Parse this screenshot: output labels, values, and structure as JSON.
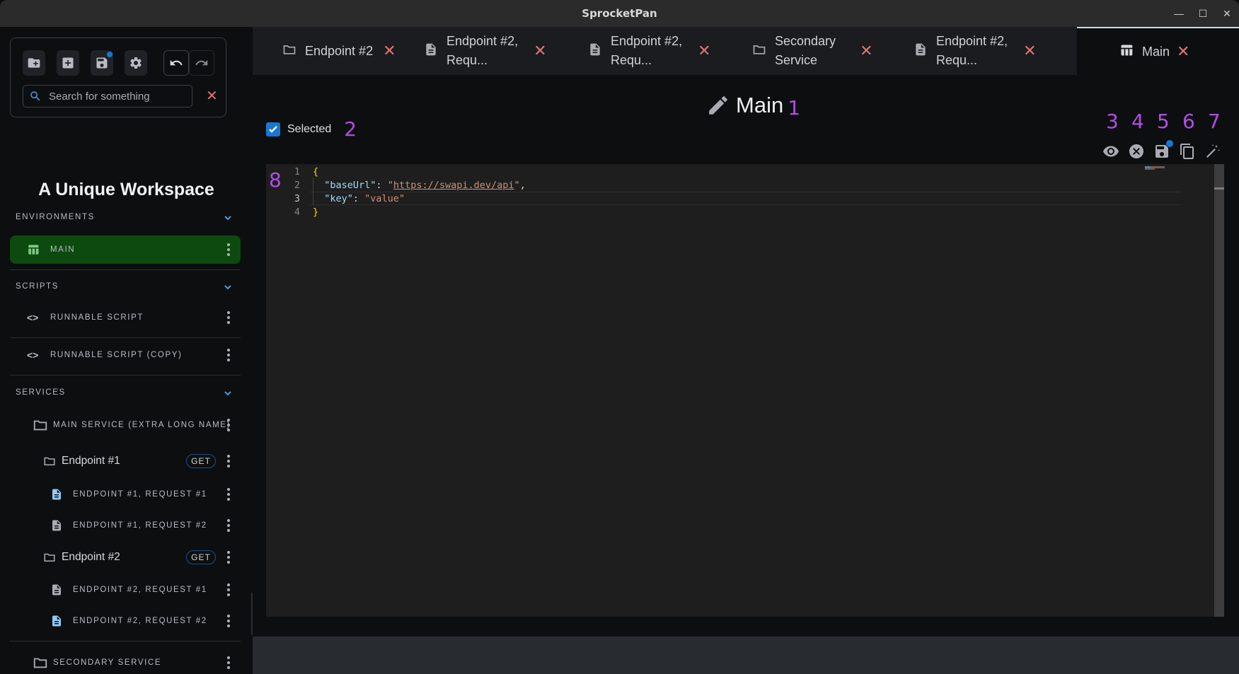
{
  "window": {
    "title": "SprocketPan",
    "controls": [
      "minimize",
      "maximize",
      "close"
    ]
  },
  "sidebar": {
    "toolbar": {
      "buttons": [
        {
          "name": "new-folder",
          "icon": "create-new-folder-icon"
        },
        {
          "name": "add",
          "icon": "add-box-icon"
        },
        {
          "name": "save",
          "icon": "save-icon",
          "has_badge": true
        },
        {
          "name": "settings",
          "icon": "gear-icon"
        },
        {
          "name": "undo",
          "icon": "undo-icon"
        },
        {
          "name": "redo",
          "icon": "redo-icon"
        }
      ],
      "search": {
        "placeholder": "Search for something",
        "value": ""
      }
    },
    "workspace_title": "A Unique Workspace",
    "sections": {
      "environments": {
        "label": "ENVIRONMENTS",
        "items": [
          {
            "label": "MAIN",
            "icon": "table-icon",
            "active": true
          }
        ]
      },
      "scripts": {
        "label": "SCRIPTS",
        "items": [
          {
            "label": "RUNNABLE SCRIPT",
            "icon": "code-icon"
          },
          {
            "label": "RUNNABLE SCRIPT (COPY)",
            "icon": "code-icon"
          }
        ]
      },
      "services": {
        "label": "SERVICES",
        "items": [
          {
            "label": "MAIN SERVICE (EXTRA LONG NAME)",
            "icon": "folder-icon",
            "level": 0
          },
          {
            "label": "Endpoint #1",
            "icon": "folder-icon",
            "level": 1,
            "method": "GET"
          },
          {
            "label": "ENDPOINT #1, REQUEST #1",
            "icon": "file-icon",
            "level": 2,
            "highlight": true
          },
          {
            "label": "ENDPOINT #1, REQUEST #2",
            "icon": "file-icon",
            "level": 2
          },
          {
            "label": "Endpoint #2",
            "icon": "folder-icon",
            "level": 1,
            "method": "GET"
          },
          {
            "label": "ENDPOINT #2, REQUEST #1",
            "icon": "file-icon",
            "level": 2
          },
          {
            "label": "ENDPOINT #2, REQUEST #2",
            "icon": "file-icon",
            "level": 2,
            "highlight": true
          },
          {
            "label": "SECONDARY SERVICE",
            "icon": "folder-icon",
            "level": 0
          }
        ]
      }
    }
  },
  "tabs": [
    {
      "label": "Endpoint #2",
      "icon": "folder-icon"
    },
    {
      "label": "Endpoint #2, Requ...",
      "line1": "Endpoint #2,",
      "line2": "Requ...",
      "icon": "file-icon"
    },
    {
      "label": "Endpoint #2, Requ...",
      "line1": "Endpoint #2,",
      "line2": "Requ...",
      "icon": "file-icon"
    },
    {
      "label": "Secondary Service",
      "line1": "Secondary",
      "line2": "Service",
      "icon": "folder-icon"
    },
    {
      "label": "Endpoint #2, Requ...",
      "line1": "Endpoint #2,",
      "line2": "Requ...",
      "icon": "file-icon"
    },
    {
      "label": "Main",
      "icon": "table-icon",
      "active": true
    }
  ],
  "main": {
    "heading": "Main",
    "selected_checkbox": {
      "label": "Selected",
      "checked": true
    },
    "annotations": [
      "1",
      "2",
      "3",
      "4",
      "5",
      "6",
      "7",
      "8"
    ],
    "actions": [
      {
        "name": "view",
        "icon": "eye-icon"
      },
      {
        "name": "cancel",
        "icon": "cancel-icon"
      },
      {
        "name": "save",
        "icon": "save-icon",
        "has_badge": true
      },
      {
        "name": "copy",
        "icon": "copy-icon"
      },
      {
        "name": "auto-fix",
        "icon": "magic-wand-icon"
      }
    ],
    "editor": {
      "line_numbers": [
        "1",
        "2",
        "3",
        "4"
      ],
      "current_line": 3,
      "lines": [
        {
          "open": "{"
        },
        {
          "key": "\"baseUrl\"",
          "sep": ": ",
          "q1": "\"",
          "value": "https://swapi.dev/api",
          "q2": "\"",
          "trail": ","
        },
        {
          "key": "\"key\"",
          "sep": ": ",
          "value": "\"value\""
        },
        {
          "close": "}"
        }
      ]
    }
  }
}
